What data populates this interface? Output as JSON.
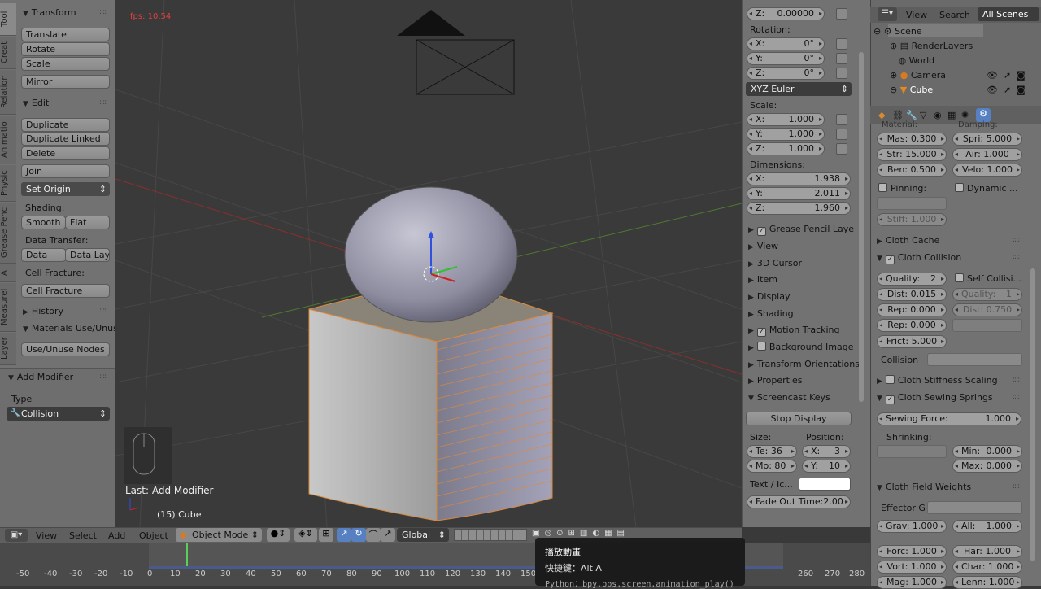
{
  "toolshelf": {
    "tabs": [
      "Tool",
      "Creat",
      "Relation",
      "Animatio",
      "Physic",
      "Grease Penc",
      "A",
      "Measurel",
      "Layer"
    ],
    "transform": {
      "header": "Transform",
      "translate": "Translate",
      "rotate": "Rotate",
      "scale": "Scale",
      "mirror": "Mirror"
    },
    "edit": {
      "header": "Edit",
      "duplicate": "Duplicate",
      "duplicate_linked": "Duplicate Linked",
      "delete": "Delete",
      "join": "Join",
      "set_origin": "Set Origin"
    },
    "shading": {
      "label": "Shading:",
      "smooth": "Smooth",
      "flat": "Flat"
    },
    "data_transfer": {
      "label": "Data Transfer:",
      "data": "Data",
      "data_lay": "Data Lay"
    },
    "cell_fracture": {
      "label": "Cell Fracture:",
      "button": "Cell Fracture"
    },
    "history": "History",
    "materials": {
      "header": "Materials Use/Unus",
      "button": "Use/Unuse Nodes"
    }
  },
  "operator": {
    "header": "Add Modifier",
    "type_label": "Type",
    "type_value": "Collision"
  },
  "viewport": {
    "fps": "fps: 10.54",
    "last_op": "Last: Add Modifier",
    "object_label": "(15) Cube"
  },
  "npanel": {
    "loc_z": {
      "label": "Z:",
      "value": "0.00000"
    },
    "rotation": {
      "label": "Rotation:",
      "x": "0°",
      "y": "0°",
      "z": "0°",
      "mode": "XYZ Euler"
    },
    "scale": {
      "label": "Scale:",
      "x": "1.000",
      "y": "1.000",
      "z": "1.000"
    },
    "dimensions": {
      "label": "Dimensions:",
      "x": "1.938",
      "y": "2.011",
      "z": "1.960"
    },
    "axes": {
      "x": "X:",
      "y": "Y:",
      "z": "Z:"
    },
    "sections": [
      "Grease Pencil Laye",
      "View",
      "3D Cursor",
      "Item",
      "Display",
      "Shading",
      "Motion Tracking",
      "Background Image",
      "Transform Orientations",
      "Properties",
      "Screencast Keys"
    ],
    "screencast": {
      "stop": "Stop Display",
      "size_label": "Size:",
      "position_label": "Position:",
      "te": "Te: 36",
      "mo": "Mo: 80",
      "x": "X:",
      "x_val": "3",
      "y": "Y:",
      "y_val": "10",
      "text_label": "Text / Ic...",
      "fade": "Fade Out Time:2.00"
    }
  },
  "outliner": {
    "view": "View",
    "search": "Search",
    "all_scenes": "All Scenes",
    "items": [
      "Scene",
      "RenderLayers",
      "World",
      "Camera",
      "Cube"
    ]
  },
  "properties": {
    "partial_top": [
      "Material:",
      "Damping:"
    ],
    "mass": "Mas: 0.300",
    "spring": "Spri: 5.000",
    "struct": "Str: 15.000",
    "air": "Air:  1.000",
    "bend": "Ben: 0.500",
    "velo": "Velo: 1.000",
    "pinning": "Pinning:",
    "dynamic": "Dynamic ...",
    "stiff": "Stiff: 1.000",
    "cloth_cache": "Cloth Cache",
    "cloth_collision": "Cloth Collision",
    "quality": "Quality:",
    "quality_val": "2",
    "self_collision": "Self Collisi...",
    "self_quality": "Quality:",
    "self_quality_val": "1",
    "dist": "Dist: 0.015",
    "rep1": "Rep: 0.000",
    "self_dist": "Dist:  0.750",
    "rep2": "Rep: 0.000",
    "frict": "Frict: 5.000",
    "collision": "Collision",
    "stiffness_scaling": "Cloth Stiffness Scaling",
    "sewing_springs": "Cloth Sewing Springs",
    "sewing_force": "Sewing Force:",
    "sewing_force_val": "1.000",
    "shrinking": "Shrinking:",
    "min": "Min:",
    "min_val": "0.000",
    "max": "Max:",
    "max_val": "0.000",
    "field_weights": "Cloth Field Weights",
    "effector": "Effector G",
    "grav": "Grav: 1.000",
    "all": "All:",
    "all_val": "1.000",
    "forc": "Forc: 1.000",
    "har": "Har:  1.000",
    "vort": "Vort: 1.000",
    "char": "Char: 1.000",
    "mag": "Mag: 1.000",
    "lenn": "Lenn: 1.000"
  },
  "header3d": {
    "view": "View",
    "select": "Select",
    "add": "Add",
    "object": "Object",
    "mode": "Object Mode",
    "orientation": "Global"
  },
  "timeline": {
    "ticks": [
      "-50",
      "-40",
      "-30",
      "-20",
      "-10",
      "0",
      "10",
      "20",
      "30",
      "40",
      "50",
      "60",
      "70",
      "80",
      "90",
      "100",
      "110",
      "120",
      "130",
      "140",
      "150",
      "260",
      "270",
      "280"
    ]
  },
  "tooltip": {
    "title": "播放動畫",
    "shortcut": "快捷鍵：Alt A",
    "python": "Python：bpy.ops.screen.animation_play()"
  },
  "colors": {
    "viewport": "#393939",
    "panel": "#727272",
    "selection": "#f09030",
    "accent": "#5680c2"
  }
}
